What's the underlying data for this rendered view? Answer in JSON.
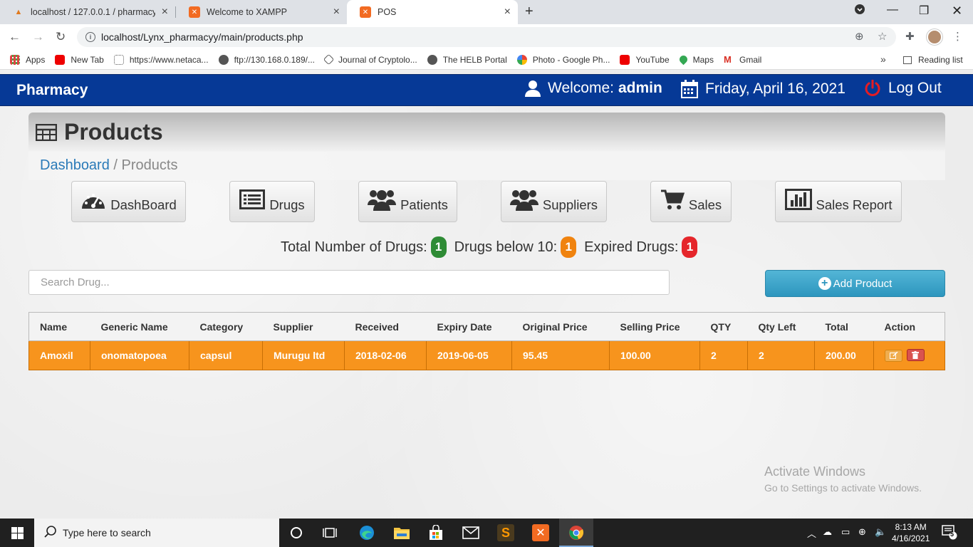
{
  "browser": {
    "tabs": [
      {
        "title": "localhost / 127.0.0.1 / pharmacy"
      },
      {
        "title": "Welcome to XAMPP"
      },
      {
        "title": "POS"
      }
    ],
    "url": "localhost/Lynx_pharmacyy/main/products.php",
    "bookmarks": [
      {
        "label": "Apps"
      },
      {
        "label": "New Tab"
      },
      {
        "label": "https://www.netaca..."
      },
      {
        "label": "ftp://130.168.0.189/..."
      },
      {
        "label": "Journal of Cryptolo..."
      },
      {
        "label": "The HELB Portal"
      },
      {
        "label": "Photo - Google Ph..."
      },
      {
        "label": "YouTube"
      },
      {
        "label": "Maps"
      },
      {
        "label": "Gmail"
      }
    ],
    "reading_list": "Reading list"
  },
  "navbar": {
    "brand": "Pharmacy",
    "welcome_label": "Welcome:",
    "user": "admin",
    "date": "Friday, April 16, 2021",
    "logout": "Log Out"
  },
  "page": {
    "title": "Products",
    "breadcrumb_home": "Dashboard",
    "breadcrumb_sep": "/",
    "breadcrumb_current": "Products"
  },
  "menu": [
    {
      "label": "DashBoard",
      "icon": "dashboard-icon"
    },
    {
      "label": "Drugs",
      "icon": "list-icon"
    },
    {
      "label": "Patients",
      "icon": "users-icon"
    },
    {
      "label": "Suppliers",
      "icon": "users-icon"
    },
    {
      "label": "Sales",
      "icon": "cart-icon"
    },
    {
      "label": "Sales Report",
      "icon": "bar-chart-icon"
    }
  ],
  "stats": {
    "total_label": "Total Number of Drugs:",
    "total_value": "1",
    "below_label": "Drugs below 10:",
    "below_value": "1",
    "expired_label": "Expired Drugs:",
    "expired_value": "1",
    "colors": {
      "total": "#2e8b35",
      "below": "#f0830f",
      "expired": "#e5262b"
    }
  },
  "search": {
    "placeholder": "Search Drug..."
  },
  "add_button": "Add Product",
  "table": {
    "headers": [
      "Name",
      "Generic Name",
      "Category",
      "Supplier",
      "Received",
      "Expiry Date",
      "Original Price",
      "Selling Price",
      "QTY",
      "Qty Left",
      "Total",
      "Action"
    ],
    "rows": [
      {
        "name": "Amoxil",
        "generic": "onomatopoea",
        "category": "capsul",
        "supplier": "Murugu ltd",
        "received": "2018-02-06",
        "expiry": "2019-06-05",
        "original_price": "95.45",
        "selling_price": "100.00",
        "qty": "2",
        "qty_left": "2",
        "total": "200.00"
      }
    ],
    "row_color": "#f7941d"
  },
  "watermark": {
    "line1": "Activate Windows",
    "line2": "Go to Settings to activate Windows."
  },
  "taskbar": {
    "search_placeholder": "Type here to search",
    "time": "8:13 AM",
    "date": "4/16/2021",
    "notifications": "5"
  }
}
